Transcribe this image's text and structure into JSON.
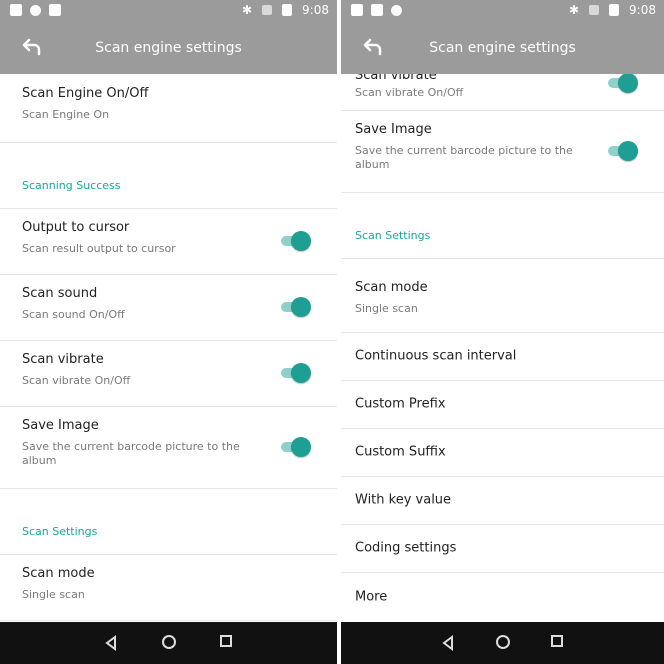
{
  "left": {
    "status": {
      "time": "9:08"
    },
    "title": "Scan engine settings",
    "items": {
      "engine": {
        "label": "Scan Engine On/Off",
        "sub": "Scan Engine On"
      },
      "section_success": "Scanning Success",
      "output": {
        "label": "Output to cursor",
        "sub": "Scan result output to cursor",
        "toggle": true
      },
      "sound": {
        "label": "Scan sound",
        "sub": "Scan sound On/Off",
        "toggle": true
      },
      "vibrate": {
        "label": "Scan vibrate",
        "sub": "Scan vibrate On/Off",
        "toggle": true
      },
      "save": {
        "label": "Save Image",
        "sub": "Save the current barcode picture to the album",
        "toggle": true
      },
      "section_settings": "Scan Settings",
      "mode": {
        "label": "Scan mode",
        "sub": "Single scan"
      }
    }
  },
  "right": {
    "status": {
      "time": "9:08"
    },
    "title": "Scan engine settings",
    "items": {
      "vibrate": {
        "label": "Scan vibrate",
        "sub": "Scan vibrate On/Off",
        "toggle": true
      },
      "save": {
        "label": "Save Image",
        "sub": "Save the current barcode picture to the album",
        "toggle": true
      },
      "section_settings": "Scan Settings",
      "mode": {
        "label": "Scan mode",
        "sub": "Single scan"
      },
      "interval": {
        "label": "Continuous scan interval"
      },
      "prefix": {
        "label": "Custom Prefix"
      },
      "suffix": {
        "label": "Custom Suffix"
      },
      "key_value": {
        "label": "With key value"
      },
      "coding": {
        "label": "Coding settings"
      },
      "more": {
        "label": "More"
      }
    }
  },
  "colors": {
    "appbar": "#9b9b9b",
    "accent": "#1f9e93",
    "navbar": "#111111"
  }
}
